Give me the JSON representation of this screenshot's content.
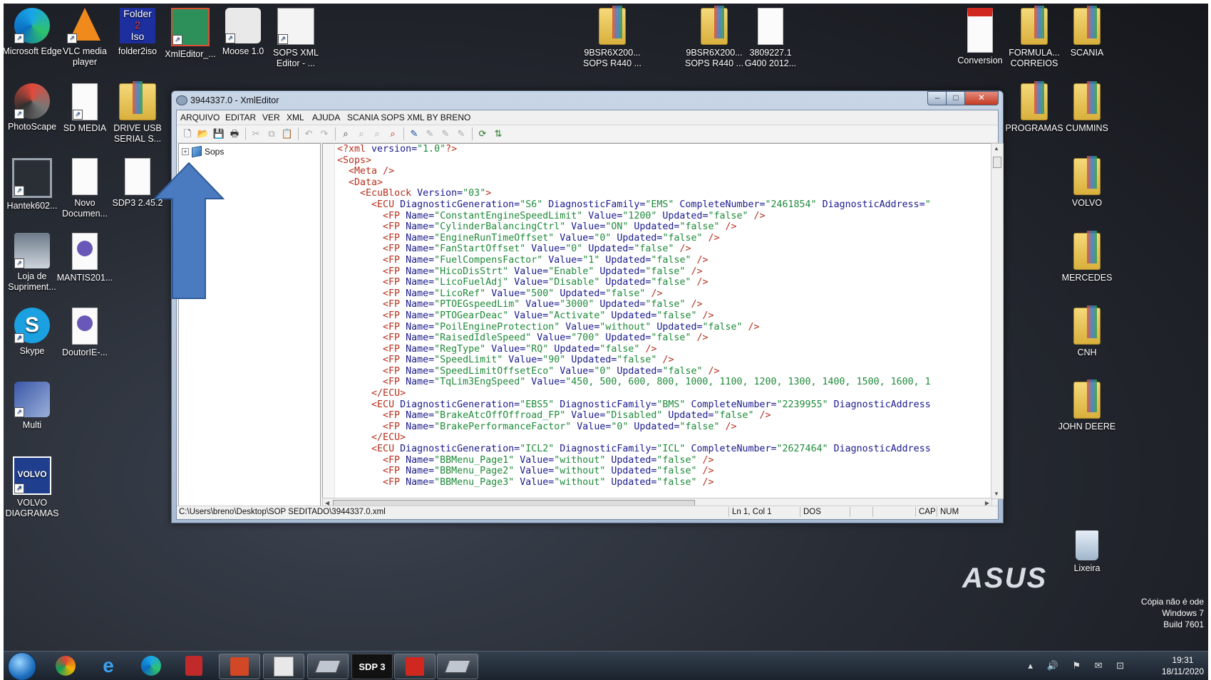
{
  "desktop_icons": [
    {
      "label": "Microsoft Edge",
      "icon": "edge-icon"
    },
    {
      "label": "VLC media player",
      "icon": "vlc-icon"
    },
    {
      "label": "folder2iso",
      "icon": "folder2iso-icon"
    },
    {
      "label": "XmlEditor_...",
      "icon": "xmleditor-icon"
    },
    {
      "label": "Moose 1.0",
      "icon": "moose-icon"
    },
    {
      "label": "SOPS XML Editor - ...",
      "icon": "sops-xml-editor-icon"
    },
    {
      "label": "9BSR6X200... SOPS R440 ...",
      "icon": "folder-icon"
    },
    {
      "label": "9BSR6X200... SOPS R440 ...",
      "icon": "folder-icon"
    },
    {
      "label": "3809227.1 G400 2012...",
      "icon": "document-icon"
    },
    {
      "label": "Conversion",
      "icon": "pdf-icon"
    },
    {
      "label": "FORMULA... CORREIOS",
      "icon": "folder-icon"
    },
    {
      "label": "SCANIA",
      "icon": "folder-icon"
    },
    {
      "label": "PhotoScape",
      "icon": "photoscape-icon"
    },
    {
      "label": "SD MEDIA",
      "icon": "document-icon"
    },
    {
      "label": "DRIVE USB SERIAL S...",
      "icon": "pdf-folder-icon"
    },
    {
      "label": "PROGRAMAS",
      "icon": "folder-icon"
    },
    {
      "label": "CUMMINS",
      "icon": "folder-icon"
    },
    {
      "label": "Hantek602...",
      "icon": "hantek-icon"
    },
    {
      "label": "Novo Documen...",
      "icon": "document-icon"
    },
    {
      "label": "SDP3 2.45.2",
      "icon": "document-icon"
    },
    {
      "label": "VOLVO",
      "icon": "folder-icon"
    },
    {
      "label": "Loja de Supriment...",
      "icon": "printer-icon"
    },
    {
      "label": "MANTIS201...",
      "icon": "torrent-icon"
    },
    {
      "label": "MERCEDES",
      "icon": "folder-icon"
    },
    {
      "label": "Skype",
      "icon": "skype-icon"
    },
    {
      "label": "DoutorIE-...",
      "icon": "torrent-icon"
    },
    {
      "label": "CNH",
      "icon": "folder-icon"
    },
    {
      "label": "Multi",
      "icon": "multi-tools-icon"
    },
    {
      "label": "JOHN DEERE",
      "icon": "folder-icon"
    },
    {
      "label": "VOLVO DIAGRAMAS",
      "icon": "volvo-icon"
    },
    {
      "label": "Lixeira",
      "icon": "recycle-bin-icon"
    }
  ],
  "window": {
    "title": "3944337.0 - XmlEditor",
    "menu": [
      "ARQUIVO",
      "EDITAR",
      "VER",
      "XML",
      "AJUDA",
      "SCANIA SOPS XML BY BRENO"
    ],
    "tree_root": "Sops",
    "status": {
      "path": "C:\\Users\\breno\\Desktop\\SOP SEDITADO\\3944337.0.xml",
      "position": "Ln 1, Col 1",
      "mode": "DOS",
      "cap": "CAP",
      "num": "NUM"
    }
  },
  "xml_lines": [
    {
      "i": 0,
      "text": "<?xml version=\"1.0\"?>"
    },
    {
      "i": 0,
      "text": "<Sops>"
    },
    {
      "i": 1,
      "text": "<Meta />"
    },
    {
      "i": 1,
      "text": "<Data>"
    },
    {
      "i": 2,
      "text": "<EcuBlock Version=\"03\">"
    },
    {
      "i": 3,
      "text": "<ECU DiagnosticGeneration=\"S6\" DiagnosticFamily=\"EMS\" CompleteNumber=\"2461854\" DiagnosticAddress=\""
    },
    {
      "i": 4,
      "text": "<FP Name=\"ConstantEngineSpeedLimit\" Value=\"1200\" Updated=\"false\" />"
    },
    {
      "i": 4,
      "text": "<FP Name=\"CylinderBalancingCtrl\" Value=\"ON\" Updated=\"false\" />"
    },
    {
      "i": 4,
      "text": "<FP Name=\"EngineRunTimeOffset\" Value=\"0\" Updated=\"false\" />"
    },
    {
      "i": 4,
      "text": "<FP Name=\"FanStartOffset\" Value=\"0\" Updated=\"false\" />"
    },
    {
      "i": 4,
      "text": "<FP Name=\"FuelCompensFactor\" Value=\"1\" Updated=\"false\" />"
    },
    {
      "i": 4,
      "text": "<FP Name=\"HicoDisStrt\" Value=\"Enable\" Updated=\"false\" />"
    },
    {
      "i": 4,
      "text": "<FP Name=\"LicoFuelAdj\" Value=\"Disable\" Updated=\"false\" />"
    },
    {
      "i": 4,
      "text": "<FP Name=\"LicoRef\" Value=\"500\" Updated=\"false\" />"
    },
    {
      "i": 4,
      "text": "<FP Name=\"PTOEGspeedLim\" Value=\"3000\" Updated=\"false\" />"
    },
    {
      "i": 4,
      "text": "<FP Name=\"PTOGearDeac\" Value=\"Activate\" Updated=\"false\" />"
    },
    {
      "i": 4,
      "text": "<FP Name=\"PoilEngineProtection\" Value=\"without\" Updated=\"false\" />"
    },
    {
      "i": 4,
      "text": "<FP Name=\"RaisedIdleSpeed\" Value=\"700\" Updated=\"false\" />"
    },
    {
      "i": 4,
      "text": "<FP Name=\"RegType\" Value=\"RQ\" Updated=\"false\" />"
    },
    {
      "i": 4,
      "text": "<FP Name=\"SpeedLimit\" Value=\"90\" Updated=\"false\" />"
    },
    {
      "i": 4,
      "text": "<FP Name=\"SpeedLimitOffsetEco\" Value=\"0\" Updated=\"false\" />"
    },
    {
      "i": 4,
      "text": "<FP Name=\"TqLim3EngSpeed\" Value=\"450, 500, 600, 800, 1000, 1100, 1200, 1300, 1400, 1500, 1600, 1"
    },
    {
      "i": 3,
      "text": "</ECU>"
    },
    {
      "i": 3,
      "text": "<ECU DiagnosticGeneration=\"EBS5\" DiagnosticFamily=\"BMS\" CompleteNumber=\"2239955\" DiagnosticAddress"
    },
    {
      "i": 4,
      "text": "<FP Name=\"BrakeAtcOffOffroad_FP\" Value=\"Disabled\" Updated=\"false\" />"
    },
    {
      "i": 4,
      "text": "<FP Name=\"BrakePerformanceFactor\" Value=\"0\" Updated=\"false\" />"
    },
    {
      "i": 3,
      "text": "</ECU>"
    },
    {
      "i": 3,
      "text": "<ECU DiagnosticGeneration=\"ICL2\" DiagnosticFamily=\"ICL\" CompleteNumber=\"2627464\" DiagnosticAddress"
    },
    {
      "i": 4,
      "text": "<FP Name=\"BBMenu_Page1\" Value=\"without\" Updated=\"false\" />"
    },
    {
      "i": 4,
      "text": "<FP Name=\"BBMenu_Page2\" Value=\"without\" Updated=\"false\" />"
    },
    {
      "i": 4,
      "text": "<FP Name=\"BBMenu_Page3\" Value=\"without\" Updated=\"false\" />"
    }
  ],
  "taskbar": {
    "buttons": [
      "chrome-icon",
      "ie-icon",
      "edge-icon",
      "antivirus-icon",
      "powerpoint-icon",
      "sops-icon",
      "scanner-icon",
      "sdp3-icon",
      "acrobat-icon",
      "scanner-icon"
    ],
    "sdp3_label": "SDP 3",
    "time": "19:31",
    "date": "18/11/2020"
  },
  "watermark": {
    "line1": "Cópia não é ode",
    "line2": "Windows 7",
    "line3": "Build 7601",
    "brand": "ASUS"
  },
  "colors": {
    "xml_tag": "#b5301e",
    "xml_attr_name": "#1a1a8c",
    "xml_attr_value": "#1f8a3a",
    "annotation_arrow": "#4a7bc0"
  }
}
